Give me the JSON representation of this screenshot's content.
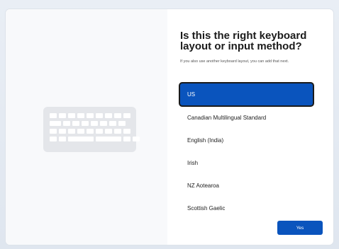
{
  "heading": {
    "title": "Is this the right keyboard layout or input method?",
    "subtitle": "If you also use another keyboard layout, you can add that next."
  },
  "layouts": {
    "selected": "US",
    "items": [
      {
        "label": "US"
      },
      {
        "label": "Canadian Multilingual Standard"
      },
      {
        "label": "English (India)"
      },
      {
        "label": "Irish"
      },
      {
        "label": "NZ Aotearoa"
      },
      {
        "label": "Scottish Gaelic"
      }
    ]
  },
  "actions": {
    "yes_label": "Yes"
  },
  "colors": {
    "accent": "#0a54bd",
    "panel": "#ffffff",
    "background": "#e6ecf3"
  },
  "icons": {
    "illustration": "keyboard-icon"
  }
}
